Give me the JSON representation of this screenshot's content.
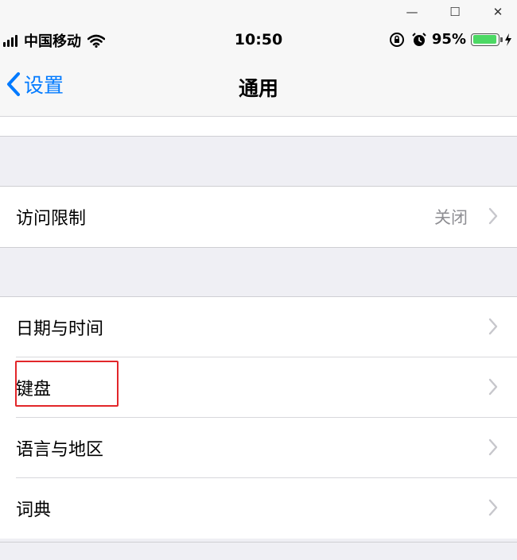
{
  "window_controls": {
    "minimize": "—",
    "maximize": "☐",
    "close": "✕"
  },
  "status_bar": {
    "carrier": "中国移动",
    "time": "10:50",
    "battery_percent": "95%",
    "battery_level": 0.95,
    "icons": [
      "signal-icon",
      "wifi-icon",
      "orientation-lock-icon",
      "alarm-icon",
      "battery-icon",
      "charging-icon"
    ]
  },
  "nav": {
    "back_label": "设置",
    "title": "通用"
  },
  "groups": [
    {
      "rows": [
        {
          "label": "访问限制",
          "value": "关闭"
        }
      ]
    },
    {
      "rows": [
        {
          "label": "日期与时间"
        },
        {
          "label": "键盘"
        },
        {
          "label": "语言与地区"
        },
        {
          "label": "词典"
        }
      ]
    }
  ],
  "colors": {
    "accent": "#007aff",
    "background": "#efeff4",
    "highlight": "#e2262a",
    "battery": "#4cd964"
  }
}
